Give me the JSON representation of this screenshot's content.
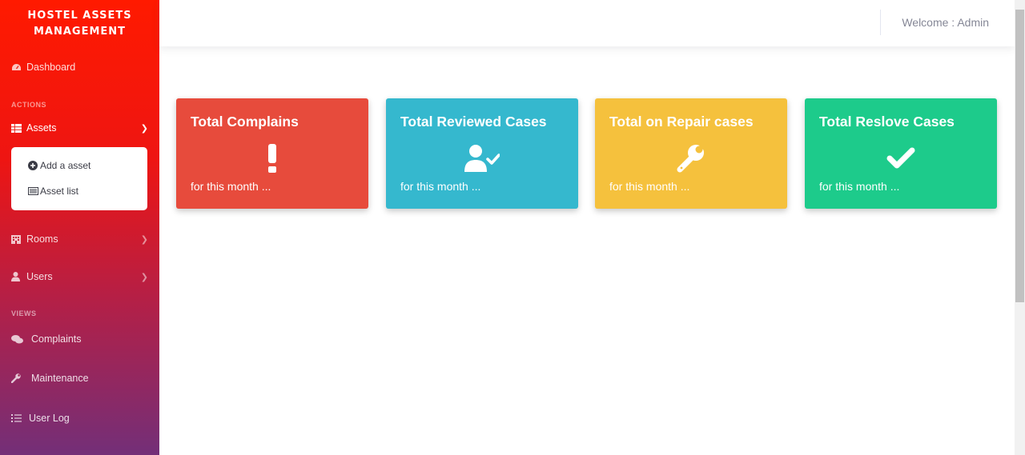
{
  "brand": {
    "line1": "HOSTEL ASSETS",
    "line2": "MANAGEMENT"
  },
  "sidebar": {
    "dashboard": {
      "label": "Dashboard",
      "icon": "tachometer-icon"
    },
    "actions_heading": "ACTIONS",
    "assets": {
      "label": "Assets",
      "icon": "table-icon",
      "expanded": true,
      "submenu": [
        {
          "label": "Add a asset",
          "icon": "plus-circle-icon"
        },
        {
          "label": "Asset list",
          "icon": "list-alt-icon"
        }
      ]
    },
    "rooms": {
      "label": "Rooms",
      "icon": "building-icon"
    },
    "users": {
      "label": "Users",
      "icon": "user-icon"
    },
    "views_heading": "VIEWS",
    "complaints": {
      "label": "Complaints",
      "icon": "comments-icon"
    },
    "maintenance": {
      "label": "Maintenance",
      "icon": "wrench-icon"
    },
    "user_log": {
      "label": "User Log",
      "icon": "list-icon"
    }
  },
  "topbar": {
    "welcome": "Welcome : Admin"
  },
  "cards": [
    {
      "title": "Total Complains",
      "subtitle": "for this month ...",
      "icon": "exclamation-icon",
      "color": "#e74b3c"
    },
    {
      "title": "Total Reviewed Cases",
      "subtitle": "for this month ...",
      "icon": "user-check-icon",
      "color": "#35b8ce"
    },
    {
      "title": "Total on Repair cases",
      "subtitle": "for this month ...",
      "icon": "wrench-icon",
      "color": "#f5c13d"
    },
    {
      "title": "Total Reslove Cases",
      "subtitle": "for this month ...",
      "icon": "check-icon",
      "color": "#1dcb8b"
    }
  ]
}
